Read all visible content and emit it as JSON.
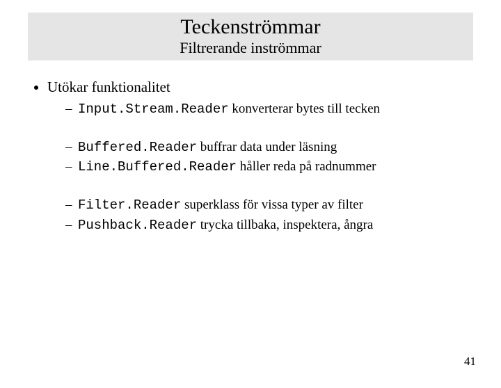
{
  "title": {
    "main": "Teckenströmmar",
    "sub": "Filtrerande inströmmar"
  },
  "bullets": {
    "level1_item": "Utökar funktionalitet",
    "group1": [
      {
        "code": "Input.Stream.Reader",
        "desc": " konverterar bytes till tecken"
      }
    ],
    "group2": [
      {
        "code": "Buffered.Reader",
        "desc": " buffrar data under läsning"
      },
      {
        "code": "Line.Buffered.Reader",
        "desc": " håller reda på radnummer"
      }
    ],
    "group3": [
      {
        "code": "Filter.Reader",
        "desc": " superklass för vissa typer av filter"
      },
      {
        "code": "Pushback.Reader",
        "desc": " trycka tillbaka, inspektera, ångra"
      }
    ]
  },
  "page_number": "41"
}
